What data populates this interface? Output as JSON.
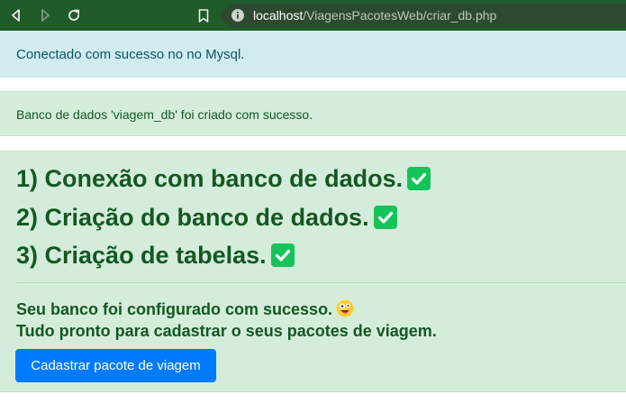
{
  "browser": {
    "url_host": "localhost",
    "url_path": "/ViagensPacotesWeb/criar_db.php"
  },
  "alerts": {
    "connection": "Conectado com sucesso no no Mysql.",
    "database": "Banco de dados 'viagem_db' foi criado com sucesso."
  },
  "steps": [
    "1) Conexão com banco de dados.",
    "2) Criação do banco de dados.",
    "3) Criação de tabelas."
  ],
  "message": {
    "line1": "Seu banco foi configurado com sucesso.",
    "line2": "Tudo pronto para cadastrar o seus pacotes de viagem."
  },
  "button": {
    "label": "Cadastrar pacote de viagem"
  },
  "colors": {
    "success_bg": "#d4edda",
    "success_text": "#155724",
    "info_bg": "#d1ecf1",
    "info_text": "#0c5460",
    "primary": "#007bff",
    "check": "#14c45a"
  },
  "icons": {
    "back": "arrow-left-icon",
    "forward": "arrow-right-icon",
    "reload": "reload-icon",
    "bookmark": "bookmark-icon",
    "site_info": "info-icon",
    "check": "check-mark-icon",
    "emoji": "zany-face-emoji"
  }
}
